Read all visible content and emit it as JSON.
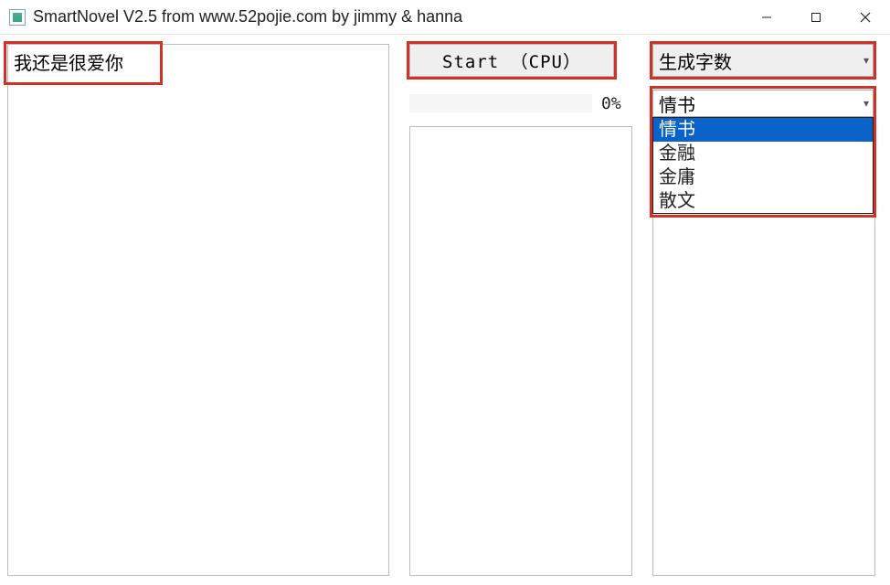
{
  "window": {
    "title": "SmartNovel V2.5  from www.52pojie.com by jimmy & hanna"
  },
  "input": {
    "text": "我还是很爱你"
  },
  "controls": {
    "start_label": "Start （CPU）",
    "progress_pct": "0%"
  },
  "count_select": {
    "selected": "生成字数"
  },
  "type_select": {
    "selected": "情书",
    "options": [
      "情书",
      "金融",
      "金庸",
      "散文"
    ],
    "highlighted_index": 0
  },
  "middle_output": "",
  "right_output": ""
}
